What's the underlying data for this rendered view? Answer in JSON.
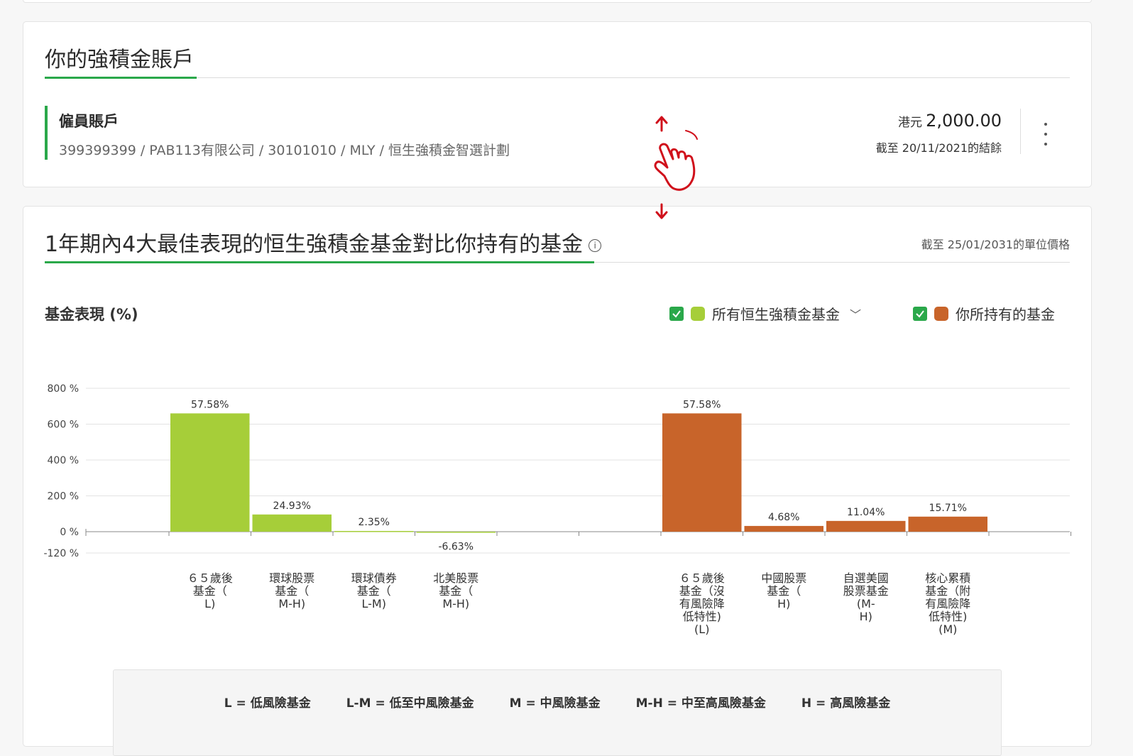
{
  "account": {
    "title": "你的強積金賬戶",
    "type": "僱員賬戶",
    "detail": "399399399 / PAB113有限公司 / 30101010 / MLY / 恒生強積金智選計劃",
    "currency": "港元",
    "balance": "2,000.00",
    "balance_date": "截至 20/11/2021的結餘"
  },
  "performance": {
    "title": "1年期內4大最佳表現的恒生強積金基金對比你持有的基金",
    "as_of": "截至  25/01/2031的單位價格",
    "label": "基金表現 (%)",
    "legend": [
      {
        "label": "所有恒生強積金基金",
        "color": "#a6ce39"
      },
      {
        "label": "你所持有的基金",
        "color": "#c8642a"
      }
    ]
  },
  "chart_data": {
    "type": "bar",
    "y_ticks": [
      {
        "label": "800 %",
        "value": 800
      },
      {
        "label": "600 %",
        "value": 600
      },
      {
        "label": "400 %",
        "value": 400
      },
      {
        "label": "200 %",
        "value": 200
      },
      {
        "label": "0 %",
        "value": 0
      },
      {
        "label": "-120 %",
        "value": -120
      }
    ],
    "ylim": [
      -120,
      800
    ],
    "series": [
      {
        "name": "所有恒生強積金基金",
        "color": "#a6ce39",
        "bars": [
          {
            "category": [
              "６５歲後",
              "基金（",
              "L)"
            ],
            "value": 660,
            "label": "57.58%"
          },
          {
            "category": [
              "環球股票",
              "基金（",
              "M-H)"
            ],
            "value": 96,
            "label": "24.93%"
          },
          {
            "category": [
              "環球債券",
              "基金（",
              "L-M)"
            ],
            "value": 4,
            "label": "2.35%"
          },
          {
            "category": [
              "北美股票",
              "基金（",
              "M-H)"
            ],
            "value": -6,
            "label": "-6.63%"
          }
        ]
      },
      {
        "name": "你所持有的基金",
        "color": "#c8642a",
        "bars": [
          {
            "category": [
              "６５歲後",
              "基金（沒",
              "有風險降",
              "低特性)",
              "(L)"
            ],
            "value": 660,
            "label": "57.58%"
          },
          {
            "category": [
              "中國股票",
              "基金（",
              "H)"
            ],
            "value": 32,
            "label": "4.68%"
          },
          {
            "category": [
              "自選美國",
              "股票基金",
              "(M-",
              "H)"
            ],
            "value": 60,
            "label": "11.04%"
          },
          {
            "category": [
              "核心累積",
              "基金（附",
              "有風險降",
              "低特性)",
              "(M)"
            ],
            "value": 84,
            "label": "15.71%"
          }
        ]
      }
    ]
  },
  "risk_legend": [
    "L = 低風險基金",
    "L-M = 低至中風險基金",
    "M = 中風險基金",
    "M-H = 中至高風險基金",
    "H = 高風險基金"
  ]
}
